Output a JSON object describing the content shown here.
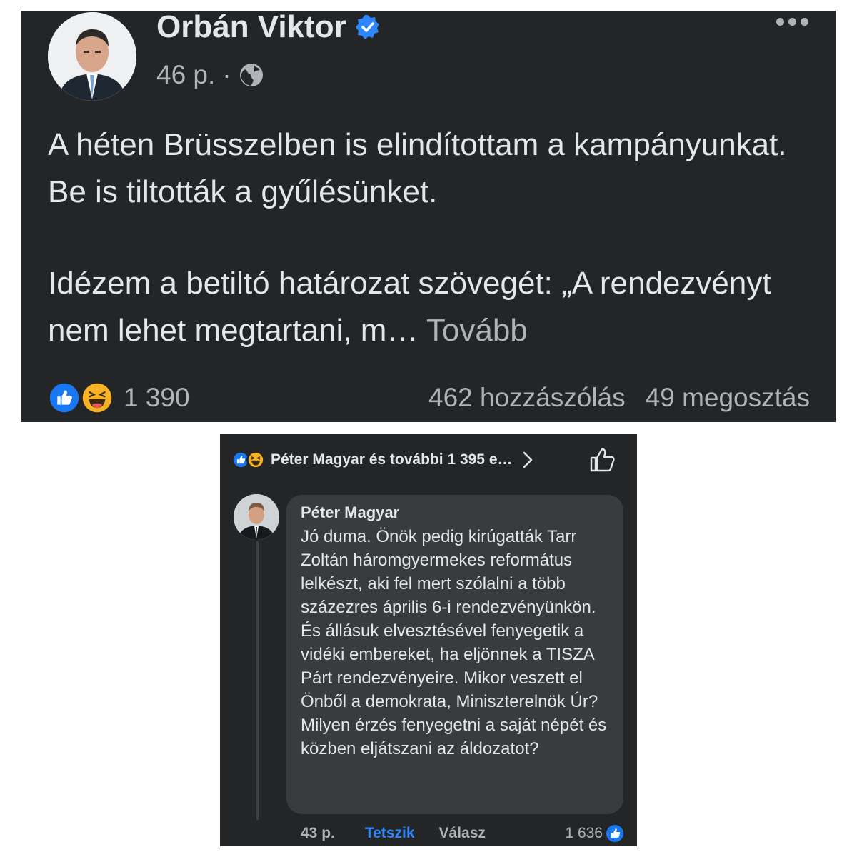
{
  "post": {
    "author": "Orbán Viktor",
    "time": "46 p.",
    "separator": "·",
    "text_p1": "A héten Brüsszelben is elindítottam a kampányunkat. Be is tiltották a gyűlésünket.",
    "text_p2": "Idézem a betiltó határozat szövegét: „A rendezvényt nem lehet megtartani, m…",
    "see_more": "Tovább",
    "reaction_count": "1 390",
    "comments": "462 hozzászólás",
    "shares": "49 megosztás",
    "icons": [
      "verified-icon",
      "globe-icon",
      "more-icon",
      "like-reaction-icon",
      "haha-reaction-icon"
    ]
  },
  "comment_view": {
    "likers": "Péter Magyar és további 1 395 e…",
    "comment": {
      "author": "Péter Magyar",
      "text": "Jó duma. Önök pedig kirúgatták Tarr Zoltán háromgyermekes református lelkészt, aki fel mert szólalni a több százezres április 6-i rendezvényünkön. És állásuk elvesztésével fenyegetik a vidéki embereket, ha eljönnek a TISZA Párt rendezvényeire. Mikor veszett el Önből a demokrata, Miniszterelnök Úr? Milyen érzés fenyegetni a saját népét és közben eljátszani az áldozatot?",
      "time": "43 p.",
      "like_label": "Tetszik",
      "reply_label": "Válasz",
      "like_count": "1 636"
    }
  },
  "colors": {
    "background": "#242526",
    "bubble": "#3a3b3c",
    "text_primary": "#e4e6eb",
    "text_secondary": "#b0b3b8",
    "accent_blue": "#2d88ff"
  }
}
